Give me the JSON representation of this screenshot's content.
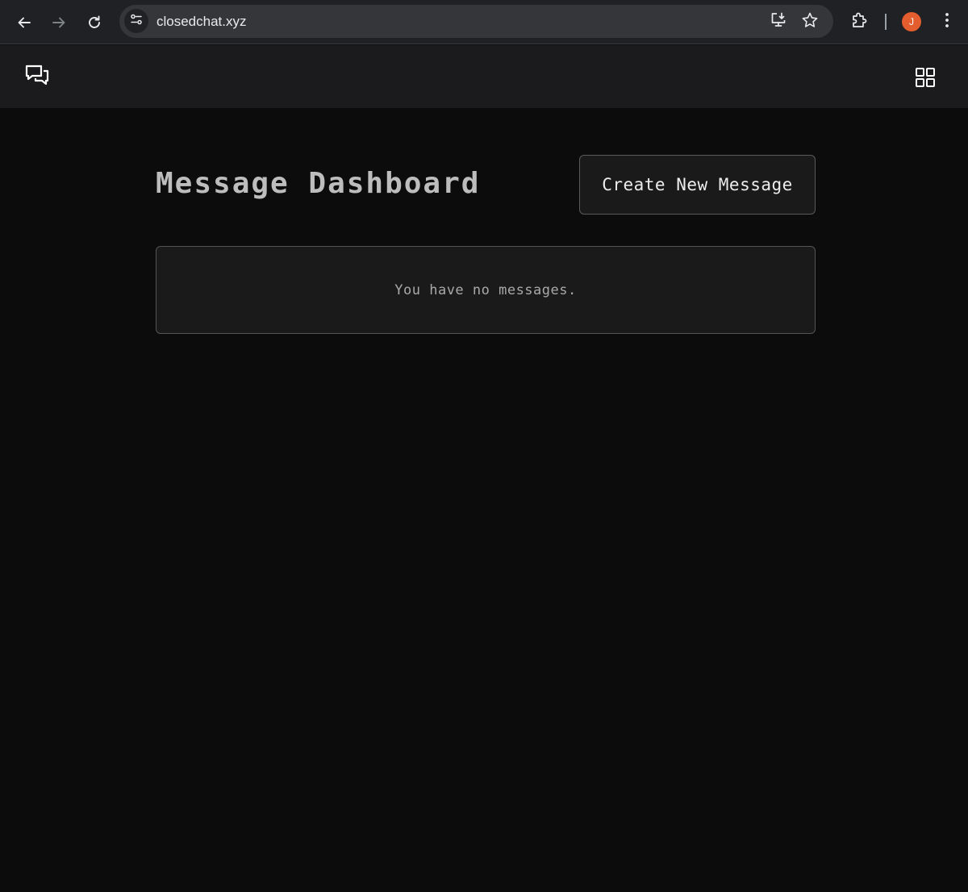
{
  "browser": {
    "url": "closedchat.xyz",
    "profile_initial": "J",
    "profile_color": "#e35d2f",
    "icons": {
      "back": "back-arrow-icon",
      "forward": "forward-arrow-icon",
      "reload": "reload-icon",
      "site_info": "site-settings-icon",
      "install": "install-app-icon",
      "bookmark": "star-icon",
      "extensions": "puzzle-icon",
      "menu": "kebab-menu-icon"
    }
  },
  "header": {
    "logo_icon": "chat-bubbles-icon",
    "menu_icon": "grid-icon"
  },
  "main": {
    "title": "Message Dashboard",
    "create_button_label": "Create New Message",
    "empty_message": "You have no messages."
  },
  "colors": {
    "page_background": "#0c0c0c",
    "header_background": "#1b1b1d",
    "card_background": "#1a1a1a",
    "border": "#555555",
    "title_text": "#bdbdbd"
  }
}
